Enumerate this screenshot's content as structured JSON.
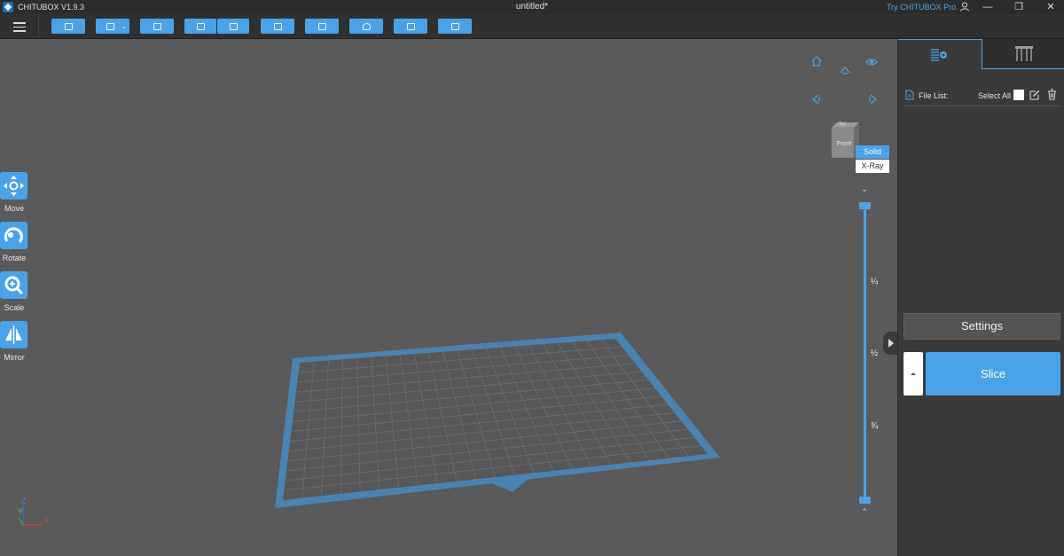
{
  "titlebar": {
    "app_title": "CHITUBOX V1.9.3",
    "doc_title": "untitled*",
    "try_pro": "Try CHITUBOX Pro",
    "min": "—",
    "restore": "❐",
    "close": "✕"
  },
  "toolbar": {
    "buttons": [
      "open-file",
      "save",
      "auto-layout",
      "import",
      "export",
      "print",
      "arrange",
      "support",
      "hollow",
      "drain"
    ]
  },
  "tools": [
    {
      "label": "Move",
      "icon": "move-icon"
    },
    {
      "label": "Rotate",
      "icon": "rotate-icon"
    },
    {
      "label": "Scale",
      "icon": "scale-icon"
    },
    {
      "label": "Mirror",
      "icon": "mirror-icon"
    }
  ],
  "view": {
    "cube_top": "Top",
    "cube_front": "Front",
    "solid": "Solid",
    "xray": "X-Ray"
  },
  "layer_slider": {
    "marks": [
      "¼",
      "½",
      "¾"
    ]
  },
  "axes": {
    "x": "X",
    "y": "Y",
    "z": "Z"
  },
  "panel": {
    "file_list_label": "File List:",
    "select_all": "Select All",
    "settings": "Settings",
    "slice": "Slice"
  },
  "colors": {
    "accent": "#4aa3e8",
    "plate": "#4f8fc0"
  }
}
